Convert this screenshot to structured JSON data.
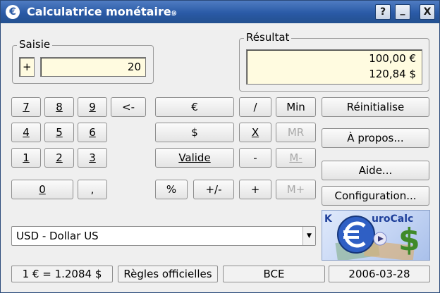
{
  "window": {
    "title": "Calculatrice monétaire",
    "app_icon": "€",
    "title_swirl": "๑",
    "help_button": "?",
    "minimize_button": "_",
    "close_button": "X"
  },
  "saisie": {
    "label": "Saisie",
    "sign": "+",
    "value": "20"
  },
  "resultat": {
    "label": "Résultat",
    "line1": "100,00 €",
    "line2": "120,84 $"
  },
  "keypad": {
    "k7": "7",
    "k8": "8",
    "k9": "9",
    "back": "<-",
    "k4": "4",
    "k5": "5",
    "k6": "6",
    "k1": "1",
    "k2": "2",
    "k3": "3",
    "k0": "0",
    "comma": ","
  },
  "ops": {
    "euro": "€",
    "dollar": "$",
    "valide": "Valide",
    "percent": "%",
    "plusminus": "+/-",
    "divide": "/",
    "multiply": "X",
    "minus": "-",
    "plus": "+"
  },
  "memory": {
    "min": "Min",
    "mr": "MR",
    "mminus": "M-",
    "mplus": "M+"
  },
  "actions": {
    "reset": "Réinitialise",
    "about": "À propos...",
    "help": "Aide...",
    "config": "Configuration..."
  },
  "currency_select": {
    "value": "USD - Dollar US",
    "arrow": "▼"
  },
  "logo": {
    "letter": "€",
    "text_k": "K",
    "text_rest": "uroCalc",
    "dollar": "$"
  },
  "status": {
    "rate": "1 € = 1.2084 $",
    "rules": "Règles officielles",
    "source": "BCE",
    "date": "2006-03-28"
  },
  "colors": {
    "titlebar": "#2a5aa6",
    "field_bg": "#fffbe0",
    "window_bg": "#efefef"
  }
}
